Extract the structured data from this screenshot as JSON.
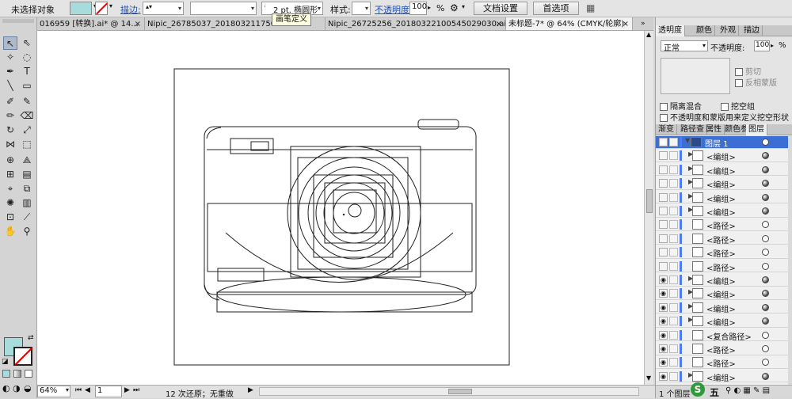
{
  "control_bar": {
    "selection_status": "未选择对象",
    "stroke_link": "描边",
    "stroke_weight_value": "",
    "brush_profile": "2 pt. 椭圆形",
    "tooltip": "画笔定义",
    "style_label": "样式:",
    "opacity_link": "不透明度",
    "opacity_value": "100",
    "percent": "%",
    "doc_setup_button": "文档设置",
    "preferences_button": "首选项",
    "colors": {
      "fill": "#a8dcdc"
    }
  },
  "doc_tabs": [
    {
      "label": "016959 [转换].ai* @ 14...",
      "closable": true
    },
    {
      "label": "Nipic_26785037_20180321175057...",
      "closable": false
    },
    {
      "label": "Nipic_26725256_20180322100545029030.ai*",
      "closable": true
    },
    {
      "label": "未标题-7* @ 64% (CMYK/轮廓)",
      "closable": true
    }
  ],
  "status_bar": {
    "zoom": "64%",
    "page": "1",
    "undo_status": "12 次还原；无重做"
  },
  "transparency_panel": {
    "tabs": [
      "透明度",
      "颜色",
      "外观",
      "描边"
    ],
    "blend_mode": "正常",
    "opacity_label": "不透明度:",
    "opacity_value": "100",
    "percent": "%",
    "clip_label": "剪切",
    "invert_mask_label": "反相蒙版",
    "isolate_blending": "隔离混合",
    "knockout_group": "挖空组",
    "opacity_mask_knockout": "不透明度和蒙版用来定义挖空形状"
  },
  "layers_panel": {
    "tabs": [
      "渐变",
      "路径查",
      "属性",
      "颜色参",
      "图层"
    ],
    "footer": "1 个图层",
    "rows": [
      {
        "name": "图层 1",
        "indent": 0,
        "expanded": true,
        "eye": true,
        "highlight": true,
        "filled": false
      },
      {
        "name": "<编组>",
        "indent": 1,
        "eye": false,
        "highlight": false,
        "filled": true
      },
      {
        "name": "<编组>",
        "indent": 1,
        "eye": false,
        "highlight": false,
        "filled": true
      },
      {
        "name": "<编组>",
        "indent": 1,
        "eye": false,
        "highlight": false,
        "filled": true
      },
      {
        "name": "<编组>",
        "indent": 1,
        "eye": false,
        "highlight": false,
        "filled": true
      },
      {
        "name": "<编组>",
        "indent": 1,
        "eye": false,
        "highlight": false,
        "filled": true
      },
      {
        "name": "<路径>",
        "indent": 1,
        "eye": false,
        "highlight": false,
        "filled": false
      },
      {
        "name": "<路径>",
        "indent": 1,
        "eye": false,
        "highlight": false,
        "filled": false
      },
      {
        "name": "<路径>",
        "indent": 1,
        "eye": false,
        "highlight": false,
        "filled": false
      },
      {
        "name": "<路径>",
        "indent": 1,
        "eye": false,
        "highlight": false,
        "filled": false
      },
      {
        "name": "<编组>",
        "indent": 1,
        "eye": true,
        "highlight": false,
        "filled": true
      },
      {
        "name": "<编组>",
        "indent": 1,
        "eye": true,
        "highlight": false,
        "filled": true
      },
      {
        "name": "<编组>",
        "indent": 1,
        "eye": true,
        "highlight": false,
        "filled": true
      },
      {
        "name": "<编组>",
        "indent": 1,
        "eye": true,
        "highlight": false,
        "filled": true
      },
      {
        "name": "<复合路径>",
        "indent": 1,
        "eye": true,
        "highlight": false,
        "filled": false
      },
      {
        "name": "<路径>",
        "indent": 1,
        "eye": true,
        "highlight": false,
        "filled": false
      },
      {
        "name": "<路径>",
        "indent": 1,
        "eye": true,
        "highlight": false,
        "filled": false
      },
      {
        "name": "<编组>",
        "indent": 1,
        "eye": true,
        "highlight": false,
        "filled": true
      }
    ]
  },
  "watermark": "五",
  "toolbox": {
    "tools": [
      "selection-tool",
      "direct-selection-tool",
      "magic-wand-tool",
      "lasso-tool",
      "pen-tool",
      "type-tool",
      "line-tool",
      "rectangle-tool",
      "paintbrush-tool",
      "pencil-tool",
      "blob-brush-tool",
      "eraser-tool",
      "rotate-tool",
      "scale-tool",
      "width-tool",
      "free-transform-tool",
      "shape-builder-tool",
      "perspective-tool",
      "mesh-tool",
      "gradient-tool",
      "eyedropper-tool",
      "blend-tool",
      "symbol-sprayer-tool",
      "column-graph-tool",
      "artboard-tool",
      "slice-tool",
      "hand-tool",
      "zoom-tool"
    ]
  }
}
